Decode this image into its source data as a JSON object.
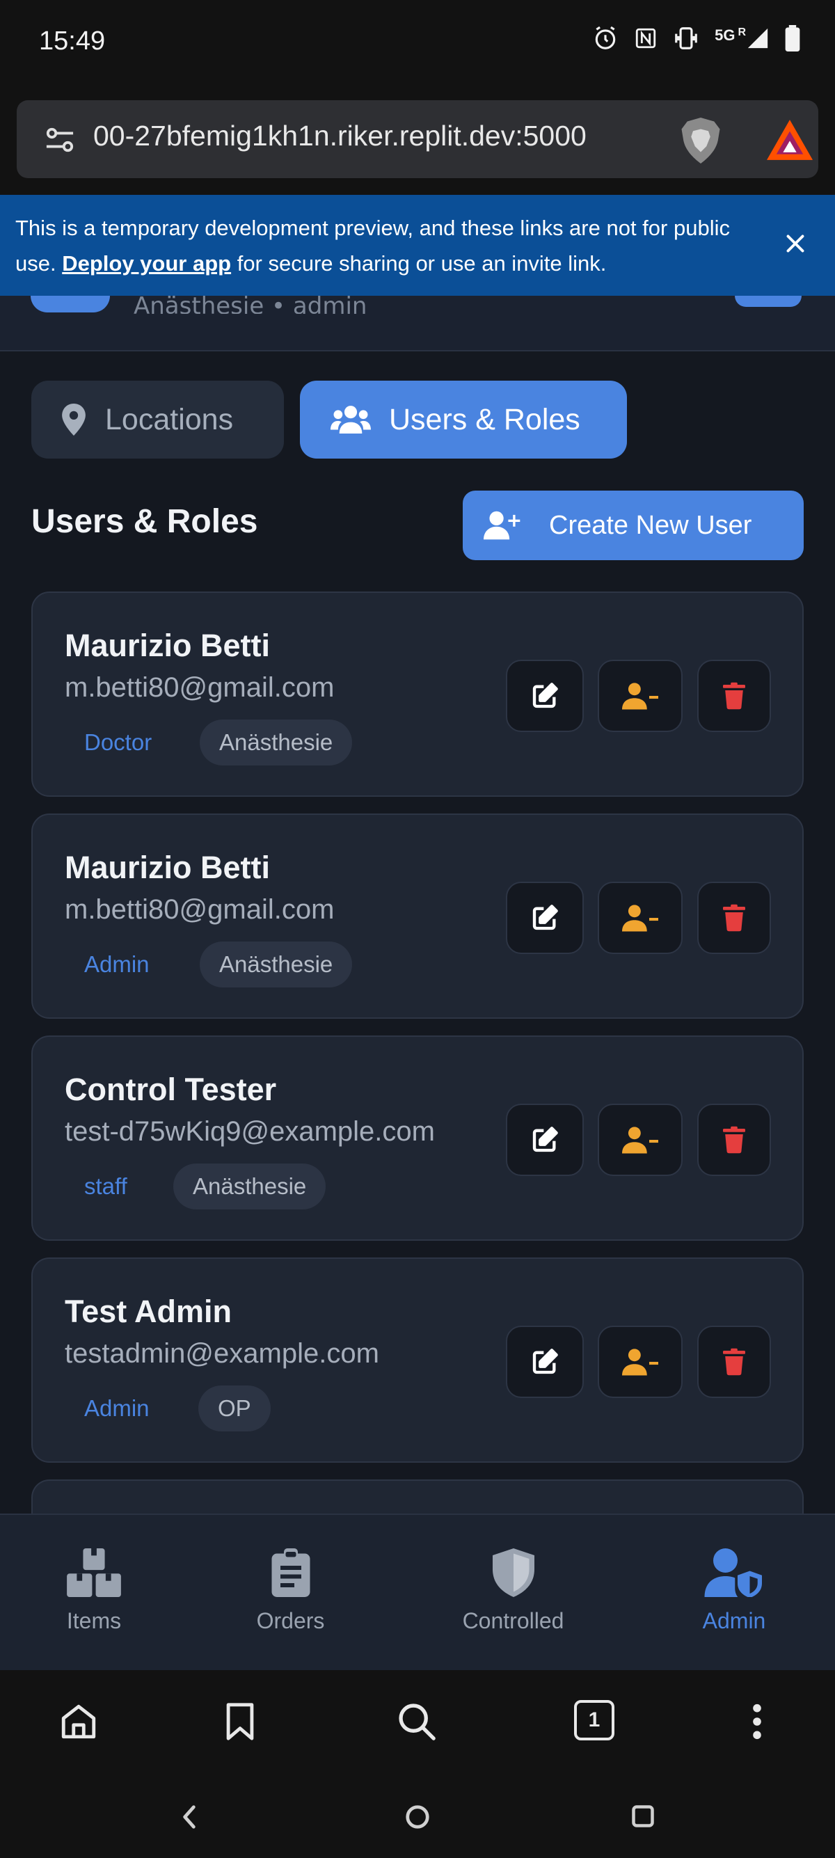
{
  "status_bar": {
    "time": "15:49",
    "network": "5G",
    "network_sup": "R"
  },
  "browser": {
    "url": "00-27bfemig1kh1n.riker.replit.dev:5000",
    "tab_count": "1"
  },
  "banner": {
    "text_before": "This is a temporary development preview, and these links are not for public use. ",
    "link": "Deploy your app",
    "text_after": " for secure sharing or use an invite link."
  },
  "header": {
    "subtitle": "Anästhesie • admin"
  },
  "tabs": [
    {
      "label": "Locations",
      "active": false,
      "icon": "map-pin-icon"
    },
    {
      "label": "Users & Roles",
      "active": true,
      "icon": "users-icon"
    }
  ],
  "section": {
    "title": "Users & Roles",
    "create_label": "Create New User"
  },
  "users": [
    {
      "name": "Maurizio Betti",
      "email": "m.betti80@gmail.com",
      "role": "Doctor",
      "unit": "Anästhesie"
    },
    {
      "name": "Maurizio Betti",
      "email": "m.betti80@gmail.com",
      "role": "Admin",
      "unit": "Anästhesie"
    },
    {
      "name": "Control Tester",
      "email": "test-d75wKiq9@example.com",
      "role": "staff",
      "unit": "Anästhesie"
    },
    {
      "name": "Test Admin",
      "email": "testadmin@example.com",
      "role": "Admin",
      "unit": "OP"
    }
  ],
  "bottom_nav": [
    {
      "label": "Items",
      "icon": "boxes-icon",
      "active": false
    },
    {
      "label": "Orders",
      "icon": "clipboard-icon",
      "active": false
    },
    {
      "label": "Controlled",
      "icon": "shield-icon",
      "active": false
    },
    {
      "label": "Admin",
      "icon": "user-shield-icon",
      "active": true
    }
  ],
  "colors": {
    "accent": "#4a84e0",
    "warning": "#f0a530",
    "danger": "#e53e3e",
    "card": "#1f2633",
    "background": "#141820"
  }
}
